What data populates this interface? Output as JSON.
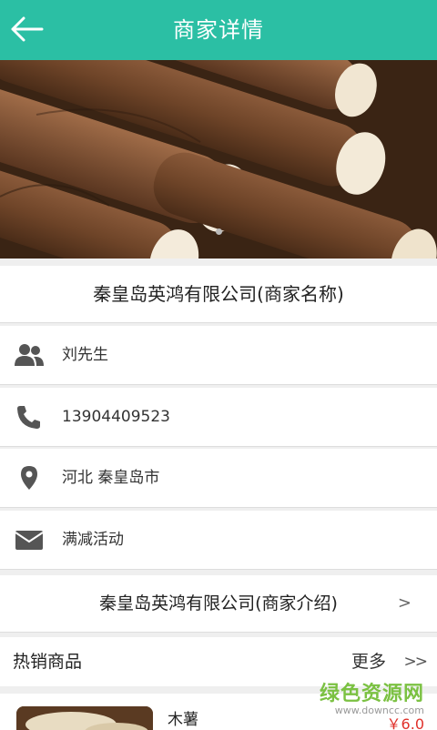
{
  "header": {
    "title": "商家详情"
  },
  "merchant": {
    "name": "秦皇岛英鸿有限公司(商家名称)",
    "contact": "刘先生",
    "phone": "13904409523",
    "location": "河北 秦皇岛市",
    "promotion": "满减活动",
    "intro": "秦皇岛英鸿有限公司(商家介绍)",
    "intro_arrow": ">"
  },
  "hot": {
    "title": "热销商品",
    "more": "更多",
    "more_arrow": ">>"
  },
  "products": [
    {
      "name": "木薯",
      "price": "￥6.0"
    }
  ],
  "watermark": {
    "brand": "绿色资源网",
    "url": "www.downcc.com"
  },
  "colors": {
    "accent": "#2bbfa4",
    "price": "#e0302a",
    "icon": "#555555"
  },
  "icons": [
    "back-arrow-icon",
    "user-group-icon",
    "phone-icon",
    "location-pin-icon",
    "mail-icon"
  ]
}
